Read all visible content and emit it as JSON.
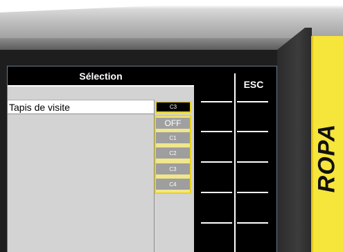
{
  "window": {
    "title": "Sélection"
  },
  "list": {
    "row_label": "Tapis de visite",
    "current_value": "C3"
  },
  "dropdown": {
    "options": [
      "OFF",
      "C1",
      "C2",
      "C3",
      "C4"
    ]
  },
  "softkeys": {
    "esc_label": "ESC"
  },
  "brand": {
    "logo_text": "ROPA"
  },
  "colors": {
    "highlight": "#e8d320",
    "screen_bg": "#000000",
    "panel_bg": "#d3d3d3",
    "housing_yellow": "#f6e53b"
  }
}
